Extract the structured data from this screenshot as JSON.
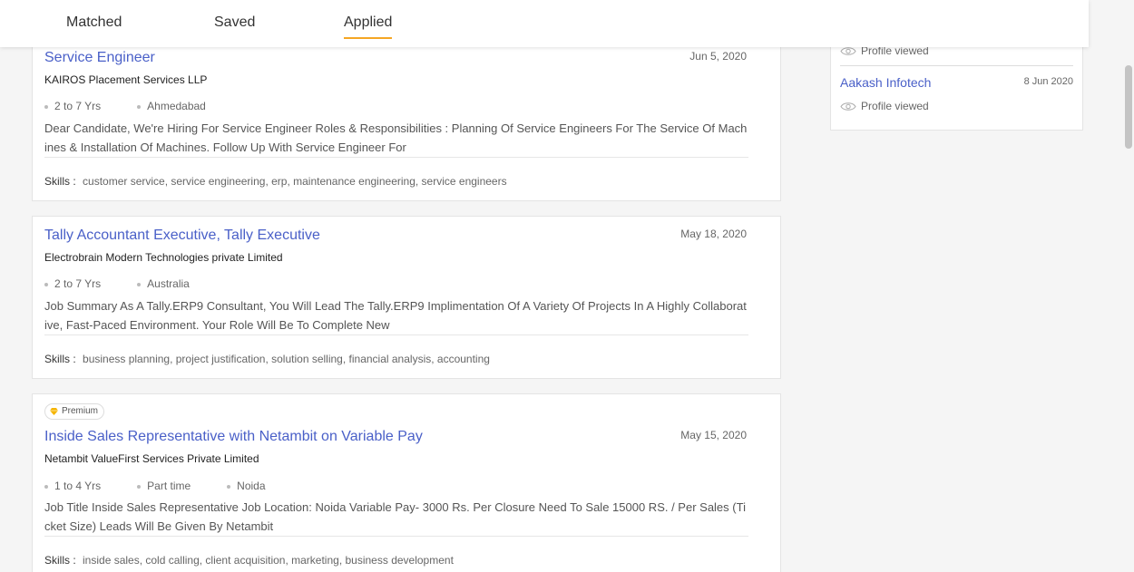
{
  "tabs": [
    {
      "label": "Matched",
      "active": false
    },
    {
      "label": "Saved",
      "active": false
    },
    {
      "label": "Applied",
      "active": true
    }
  ],
  "jobs": [
    {
      "title": "Service Engineer",
      "date": "Jun 5, 2020",
      "company": "KAIROS Placement Services LLP",
      "meta": [
        "2 to 7 Yrs",
        "Ahmedabad"
      ],
      "description": "Dear Candidate, We're Hiring For Service Engineer Roles & Responsibilities : Planning Of Service Engineers For The Service Of Machines & Installation Of Machines. Follow Up With Service Engineer For",
      "skills_label": "Skills :",
      "skills": "customer service, service engineering, erp, maintenance engineering, service engineers"
    },
    {
      "title": "Tally Accountant Executive, Tally Executive",
      "date": "May 18, 2020",
      "company": "Electrobrain Modern Technologies private Limited",
      "meta": [
        "2 to 7 Yrs",
        "Australia"
      ],
      "description": "Job Summary As A Tally.ERP9 Consultant, You Will Lead The Tally.ERP9 Implimentation Of A Variety Of Projects In A Highly Collaborative, Fast-Paced Environment. Your Role Will Be To Complete New",
      "skills_label": "Skills :",
      "skills": "business planning, project justification, solution selling, financial analysis, accounting"
    },
    {
      "badge": "Premium",
      "title": "Inside Sales Representative with Netambit on Variable Pay",
      "date": "May 15, 2020",
      "company": "Netambit ValueFirst Services Private Limited",
      "meta": [
        "1 to 4 Yrs",
        "Part time",
        "Noida"
      ],
      "description": "Job Title Inside Sales Representative Job Location: Noida Variable Pay- 3000 Rs. Per Closure Need To Sale 15000 RS. / Per Sales (Ticket Size) Leads Will Be Given By Netambit",
      "skills_label": "Skills :",
      "skills": "inside sales, cold calling, client acquisition, marketing, business development"
    }
  ],
  "side": {
    "row1_label": "Profile viewed",
    "company": "Aakash Infotech",
    "date": "8 Jun 2020",
    "row2_label": "Profile viewed"
  },
  "colors": {
    "link": "#4a60c8",
    "tab_underline": "#f5a623",
    "premium_gem": "#f5b400"
  }
}
